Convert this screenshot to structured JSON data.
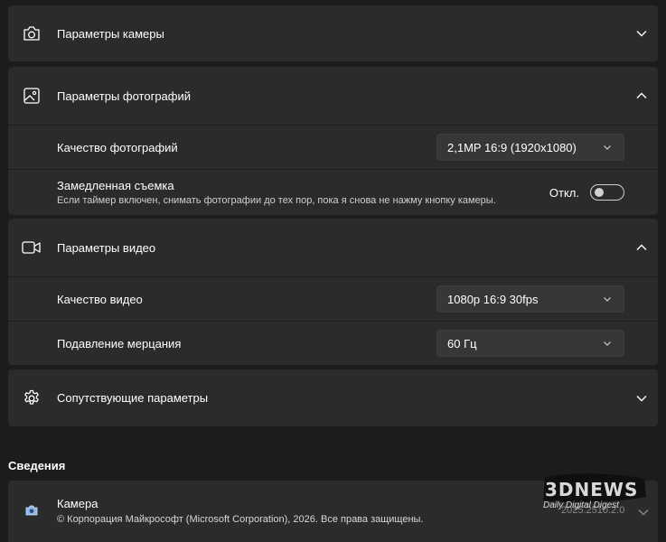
{
  "camera_settings": {
    "title": "Параметры камеры",
    "icon": "camera-icon"
  },
  "photo_settings": {
    "title": "Параметры фотографий",
    "icon": "image-icon",
    "quality_label": "Качество фотографий",
    "quality_value": "2,1MP 16:9 (1920x1080)",
    "timelapse_title": "Замедленная съемка",
    "timelapse_desc": "Если таймер включен, снимать фотографии до тех пор, пока я снова не нажму кнопку камеры.",
    "timelapse_state": "Откл."
  },
  "video_settings": {
    "title": "Параметры видео",
    "icon": "video-icon",
    "quality_label": "Качество видео",
    "quality_value": "1080p 16:9 30fps",
    "flicker_label": "Подавление мерцания",
    "flicker_value": "60 Гц"
  },
  "related_settings": {
    "title": "Сопутствующие параметры",
    "icon": "gear-icon"
  },
  "about": {
    "section_title": "Сведения",
    "app_name": "Камера",
    "copyright": "© Корпорация Майкрософт (Microsoft Corporation), 2026. Все права защищены.",
    "version": "2025.2510.2.0"
  },
  "watermark": {
    "brand": "3DNEWS",
    "tagline": "Daily Digital Digest"
  }
}
